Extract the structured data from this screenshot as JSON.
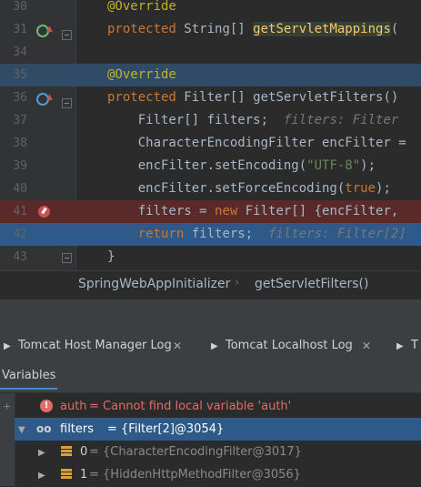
{
  "editor": {
    "lines": [
      {
        "num": "30",
        "tokens": [
          {
            "t": "@Override",
            "c": "ann"
          }
        ]
      },
      {
        "num": "31",
        "tokens": [
          {
            "t": "protected ",
            "c": "kw"
          },
          {
            "t": "String[] ",
            "c": ""
          },
          {
            "t": "getServletMappings",
            "c": "meth"
          },
          {
            "t": "(",
            "c": ""
          }
        ]
      },
      {
        "num": "34",
        "tokens": []
      },
      {
        "num": "35",
        "tokens": [
          {
            "t": "@Override",
            "c": "ann"
          }
        ]
      },
      {
        "num": "36",
        "tokens": [
          {
            "t": "protected ",
            "c": "kw"
          },
          {
            "t": "Filter[] getServletFilters()",
            "c": ""
          }
        ]
      },
      {
        "num": "37",
        "tokens": [
          {
            "t": "    Filter[] filters;  ",
            "c": ""
          },
          {
            "t": "filters: Filter",
            "c": "hint"
          }
        ]
      },
      {
        "num": "38",
        "tokens": [
          {
            "t": "    CharacterEncodingFilter encFilter =",
            "c": ""
          }
        ]
      },
      {
        "num": "39",
        "tokens": [
          {
            "t": "    encFilter.setEncoding(",
            "c": ""
          },
          {
            "t": "\"UTF-8\"",
            "c": "str"
          },
          {
            "t": ");",
            "c": ""
          }
        ]
      },
      {
        "num": "40",
        "tokens": [
          {
            "t": "    encFilter.setForceEncoding(",
            "c": ""
          },
          {
            "t": "true",
            "c": "kw"
          },
          {
            "t": ");",
            "c": ""
          }
        ]
      },
      {
        "num": "41",
        "tokens": [
          {
            "t": "    filters = ",
            "c": ""
          },
          {
            "t": "new ",
            "c": "kw"
          },
          {
            "t": "Filter[] {encFilter,",
            "c": ""
          }
        ]
      },
      {
        "num": "42",
        "tokens": [
          {
            "t": "    ",
            "c": ""
          },
          {
            "t": "return ",
            "c": "kw"
          },
          {
            "t": "filters;  ",
            "c": ""
          },
          {
            "t": "filters: Filter[2]",
            "c": "hint"
          }
        ]
      },
      {
        "num": "43",
        "tokens": [
          {
            "t": "}",
            "c": ""
          }
        ]
      }
    ]
  },
  "breadcrumb": {
    "class_name": "SpringWebAppInitializer",
    "method_name": "getServletFilters()"
  },
  "tabs": [
    {
      "label": "Tomcat Host Manager Log"
    },
    {
      "label": "Tomcat Localhost Log"
    },
    {
      "label": "T"
    }
  ],
  "variables": {
    "title": "Variables",
    "rows": [
      {
        "name": "auth",
        "value": " = Cannot find local variable 'auth'"
      },
      {
        "name": "filters",
        "value": " = {Filter[2]@3054}"
      },
      {
        "name": "0",
        "value": " = {CharacterEncodingFilter@3017}"
      },
      {
        "name": "1",
        "value": " = {HiddenHttpMethodFilter@3056}"
      }
    ]
  },
  "colors": {
    "accent": "#4a88c7",
    "selection": "#2d5a88",
    "error": "#e06c6c",
    "breakpoint": "#c75450"
  }
}
